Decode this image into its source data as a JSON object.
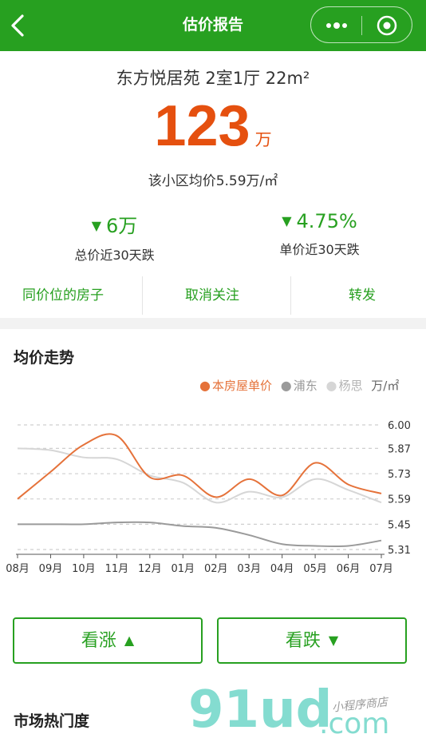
{
  "nav": {
    "title": "估价报告",
    "back_icon": "chevron-left-icon",
    "more_icon": "more-dots-icon",
    "close_icon": "target-circle-icon",
    "bg_color": "#27a020"
  },
  "house": {
    "title": "东方悦居苑 2室1厅 22m²",
    "price": "123",
    "price_unit": "万",
    "avg_text": "该小区均价5.59万/㎡"
  },
  "stats": [
    {
      "value": "6万",
      "label": "总价近30天跌",
      "arrow": "▼"
    },
    {
      "value": "4.75%",
      "label": "单价近30天跌",
      "arrow": "▼"
    }
  ],
  "actions": [
    "同价位的房子",
    "取消关注",
    "转发"
  ],
  "trend": {
    "title": "均价走势",
    "legend": [
      {
        "name": "本房屋单价",
        "color": "#e5723a"
      },
      {
        "name": "浦东",
        "color": "#9a9a9a"
      },
      {
        "name": "杨思",
        "color": "#d6d6d6"
      }
    ],
    "unit": "万/㎡"
  },
  "chart_data": {
    "type": "line",
    "categories": [
      "08月",
      "09月",
      "10月",
      "11月",
      "12月",
      "01月",
      "02月",
      "03月",
      "04月",
      "05月",
      "06月",
      "07月"
    ],
    "y_ticks": [
      "6.00",
      "5.87",
      "5.73",
      "5.59",
      "5.45",
      "5.31"
    ],
    "ylim": [
      5.31,
      6.0
    ],
    "grid": true,
    "legend_position": "top-right",
    "series": [
      {
        "name": "本房屋单价",
        "color": "#e5723a",
        "values": [
          5.59,
          5.74,
          5.89,
          5.94,
          5.71,
          5.72,
          5.6,
          5.7,
          5.61,
          5.79,
          5.67,
          5.62
        ]
      },
      {
        "name": "浦东",
        "color": "#9a9a9a",
        "values": [
          5.45,
          5.45,
          5.45,
          5.46,
          5.46,
          5.44,
          5.43,
          5.39,
          5.34,
          5.33,
          5.33,
          5.36
        ]
      },
      {
        "name": "杨思",
        "color": "#d6d6d6",
        "values": [
          5.87,
          5.86,
          5.82,
          5.81,
          5.72,
          5.68,
          5.57,
          5.63,
          5.6,
          5.7,
          5.64,
          5.57
        ]
      }
    ]
  },
  "votes": {
    "up": "看涨",
    "down": "看跌"
  },
  "market": {
    "title": "市场热门度"
  },
  "watermark": {
    "logo": "91ud",
    "suffix": ".com",
    "tagline": "小程序商店"
  }
}
